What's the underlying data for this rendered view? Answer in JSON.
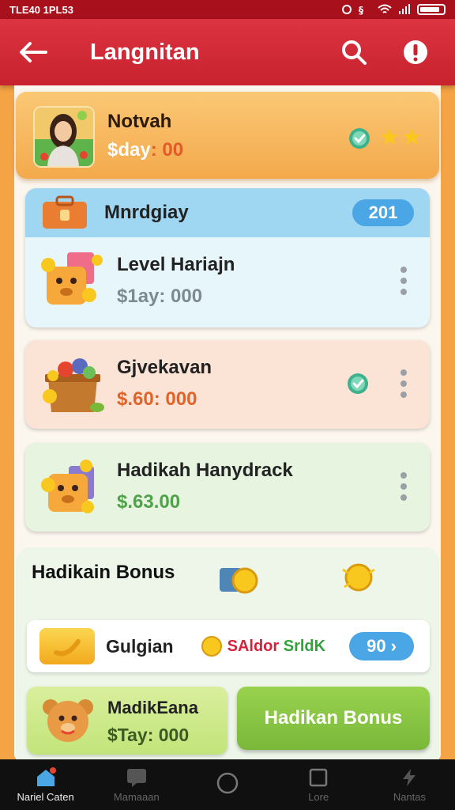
{
  "status_bar": {
    "time_text": "TLE40 1PL53"
  },
  "app_bar": {
    "title": "Langnitan"
  },
  "profile": {
    "name": "Notvah",
    "amount_prefix": "$day",
    "amount_value": ": 00",
    "stars": 2
  },
  "section": {
    "title": "Mnrdgiay",
    "count": "201",
    "items": [
      {
        "title": "Level Hariajn",
        "amount": "$1ay: 000",
        "amount_color": "#7d8a8f"
      }
    ]
  },
  "cards": [
    {
      "title": "Gjvekavan",
      "amount": "$.60: 000",
      "amount_color": "#e0642a",
      "verified": true,
      "bg": "#fbe3d6"
    },
    {
      "title": "Hadikah Hanydrack",
      "amount": "$.63.00",
      "amount_color": "#4fa24a",
      "verified": false,
      "bg": "#e6f4e0"
    }
  ],
  "bonus": {
    "title": "Hadikain Bonus",
    "promo": {
      "label": "Gulgian",
      "tag_a": "SAldor",
      "tag_b": "SrldK",
      "pill": "90"
    },
    "mini": {
      "name": "MadikEana",
      "amount": "$Tay: 000"
    },
    "button_label": "Hadikan Bonus"
  },
  "bottom_nav": [
    {
      "label": "Nariel Caten",
      "icon": "home-icon",
      "active": true
    },
    {
      "label": "Mamaaan",
      "icon": "chat-icon",
      "active": false
    },
    {
      "label": "",
      "icon": "circle-home-icon",
      "active": false
    },
    {
      "label": "Lore",
      "icon": "square-icon",
      "active": false
    },
    {
      "label": "Nantas",
      "icon": "bolt-icon",
      "active": false
    }
  ],
  "colors": {
    "app_bar": "#c8222f",
    "accent_blue": "#4aa6e4",
    "bonus_green": "#7ab83a",
    "page_orange": "#f4a445"
  }
}
